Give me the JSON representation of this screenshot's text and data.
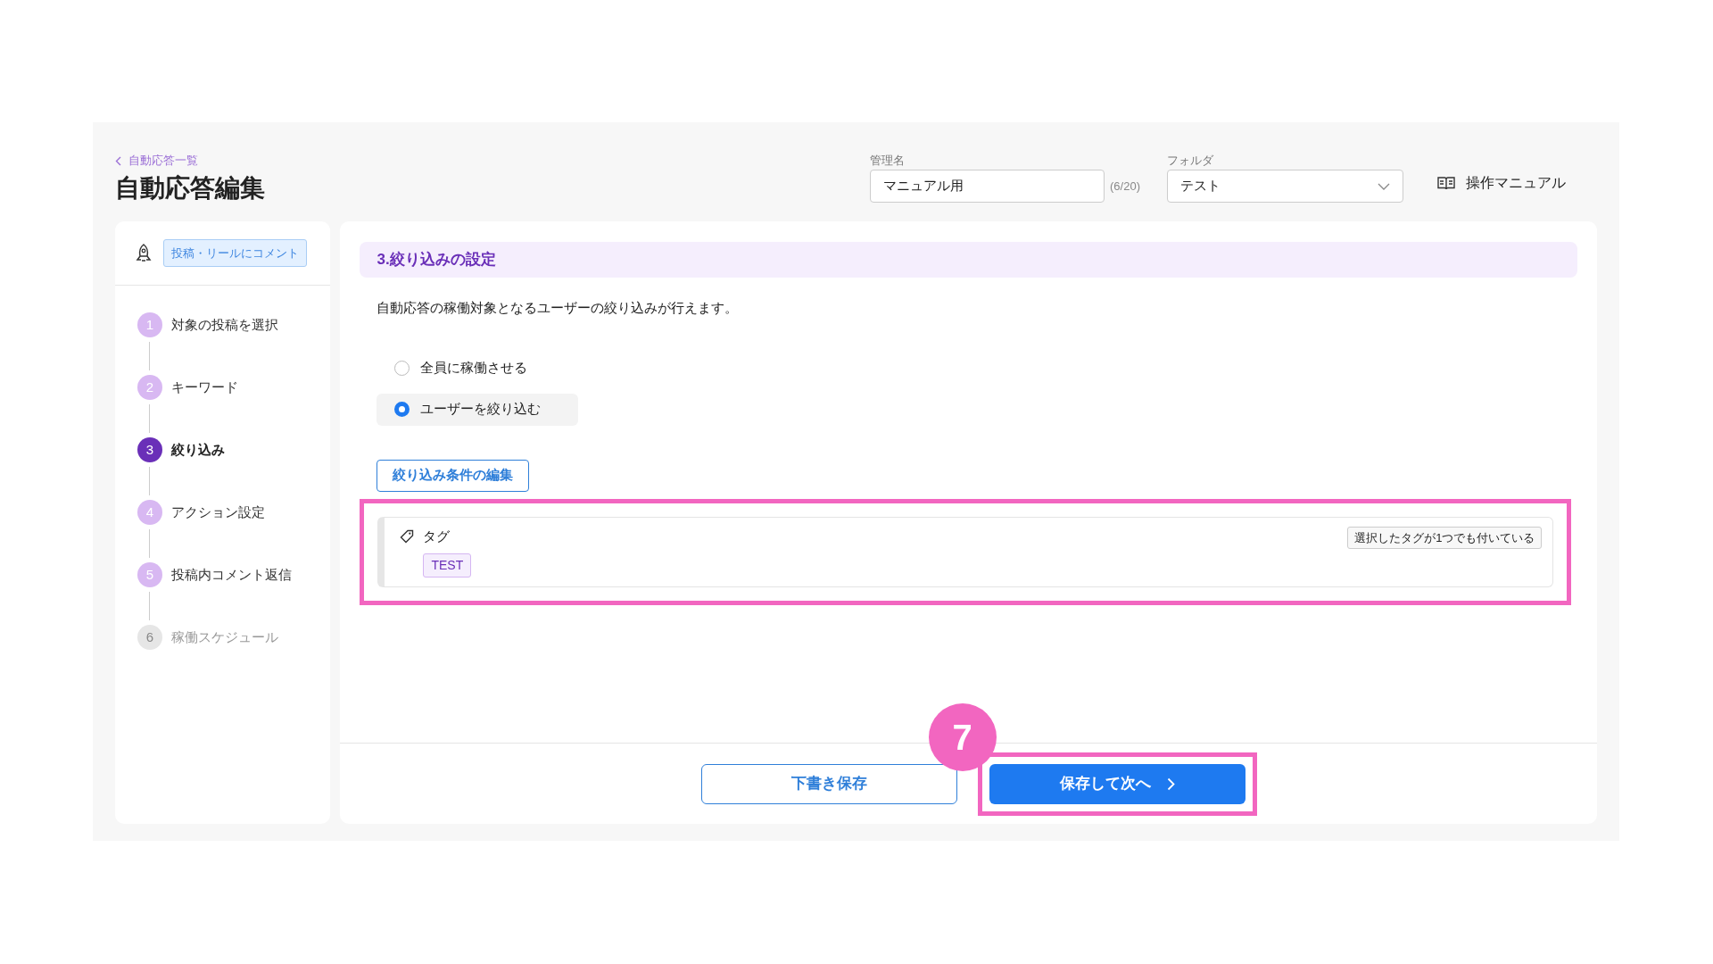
{
  "header": {
    "back_link": "自動応答一覧",
    "title": "自動応答編集"
  },
  "name_field": {
    "label": "管理名",
    "value": "マニュアル用",
    "counter": "(6/20)"
  },
  "folder_field": {
    "label": "フォルダ",
    "value": "テスト"
  },
  "manual_link": "操作マニュアル",
  "sidebar": {
    "trigger_badge": "投稿・リールにコメント",
    "steps": [
      {
        "number": "1",
        "label": "対象の投稿を選択",
        "selected": false,
        "disabled": false
      },
      {
        "number": "2",
        "label": "キーワード",
        "selected": false,
        "disabled": false
      },
      {
        "number": "3",
        "label": "絞り込み",
        "selected": true,
        "disabled": false
      },
      {
        "number": "4",
        "label": "アクション設定",
        "selected": false,
        "disabled": false
      },
      {
        "number": "5",
        "label": "投稿内コメント返信",
        "selected": false,
        "disabled": false
      },
      {
        "number": "6",
        "label": "稼働スケジュール",
        "selected": false,
        "disabled": true
      }
    ]
  },
  "section": {
    "title": "3.絞り込みの設定",
    "description": "自動応答の稼働対象となるユーザーの絞り込みが行えます。",
    "options": [
      {
        "label": "全員に稼働させる",
        "selected": false
      },
      {
        "label": "ユーザーを絞り込む",
        "selected": true
      }
    ],
    "edit_button": "絞り込み条件の編集",
    "condition": {
      "label": "タグ",
      "match": "選択したタグが1つでも付いている",
      "tags": [
        "TEST"
      ],
      "highlighted": true
    }
  },
  "footer": {
    "buttons": [
      {
        "label": "下書き保存",
        "kind": "outline",
        "highlighted": false
      },
      {
        "label": "保存して次へ",
        "kind": "primary",
        "highlighted": true
      }
    ]
  },
  "annotation": {
    "step": "7"
  }
}
